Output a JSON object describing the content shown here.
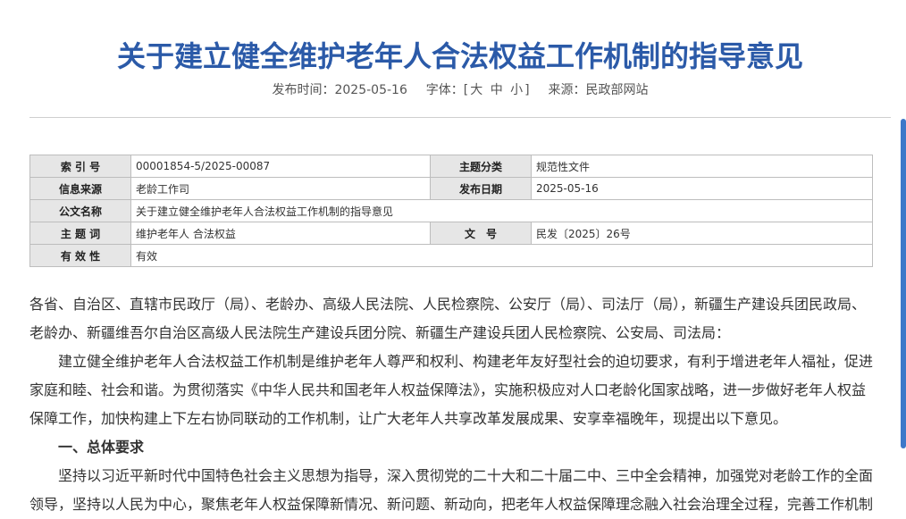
{
  "article": {
    "title": "关于建立健全维护老年人合法权益工作机制的指导意见",
    "meta": {
      "publish_label": "发布时间：",
      "publish_date": "2025-05-16",
      "font_label": "字体：",
      "font_open": "[",
      "font_large": "大",
      "font_medium": "中",
      "font_small": "小",
      "font_close": "]",
      "source_label": "来源：",
      "source_value": "民政部网站"
    }
  },
  "info_table": {
    "index_label": "索 引 号",
    "index_value": "00001854-5/2025-00087",
    "category_label": "主题分类",
    "category_value": "规范性文件",
    "source_label": "信息来源",
    "source_value": "老龄工作司",
    "date_label": "发布日期",
    "date_value": "2025-05-16",
    "doc_name_label": "公文名称",
    "doc_name_value": "关于建立健全维护老年人合法权益工作机制的指导意见",
    "keywords_label": "主 题 词",
    "keywords_value": "维护老年人 合法权益",
    "doc_no_label": "文　号",
    "doc_no_value": "民发〔2025〕26号",
    "validity_label": "有 效 性",
    "validity_value": "有效"
  },
  "body": {
    "addressees": "各省、自治区、直辖市民政厅（局）、老龄办、高级人民法院、人民检察院、公安厅（局）、司法厅（局），新疆生产建设兵团民政局、老龄办、新疆维吾尔自治区高级人民法院生产建设兵团分院、新疆生产建设兵团人民检察院、公安局、司法局：",
    "intro": "建立健全维护老年人合法权益工作机制是维护老年人尊严和权利、构建老年友好型社会的迫切要求，有利于增进老年人福祉，促进家庭和睦、社会和谐。为贯彻落实《中华人民共和国老年人权益保障法》，实施积极应对人口老龄化国家战略，进一步做好老年人权益保障工作，加快构建上下左右协同联动的工作机制，让广大老年人共享改革发展成果、安享幸福晚年，现提出以下意见。",
    "section1_heading": "一、总体要求",
    "section1_text": "坚持以习近平新时代中国特色社会主义思想为指导，深入贯彻党的二十大和二十届二中、三中全会精神，加强党对老龄工作的全面领导，坚持以人民为中心，聚焦老年人权益保障新情况、新问题、新动向，把老年人权益保障理念融入社会治理全过程，完善工作机制"
  },
  "colors": {
    "title": "#2b5aa8",
    "scrollbar": "#3d78c9",
    "label_bg": "#e6e6e6"
  }
}
